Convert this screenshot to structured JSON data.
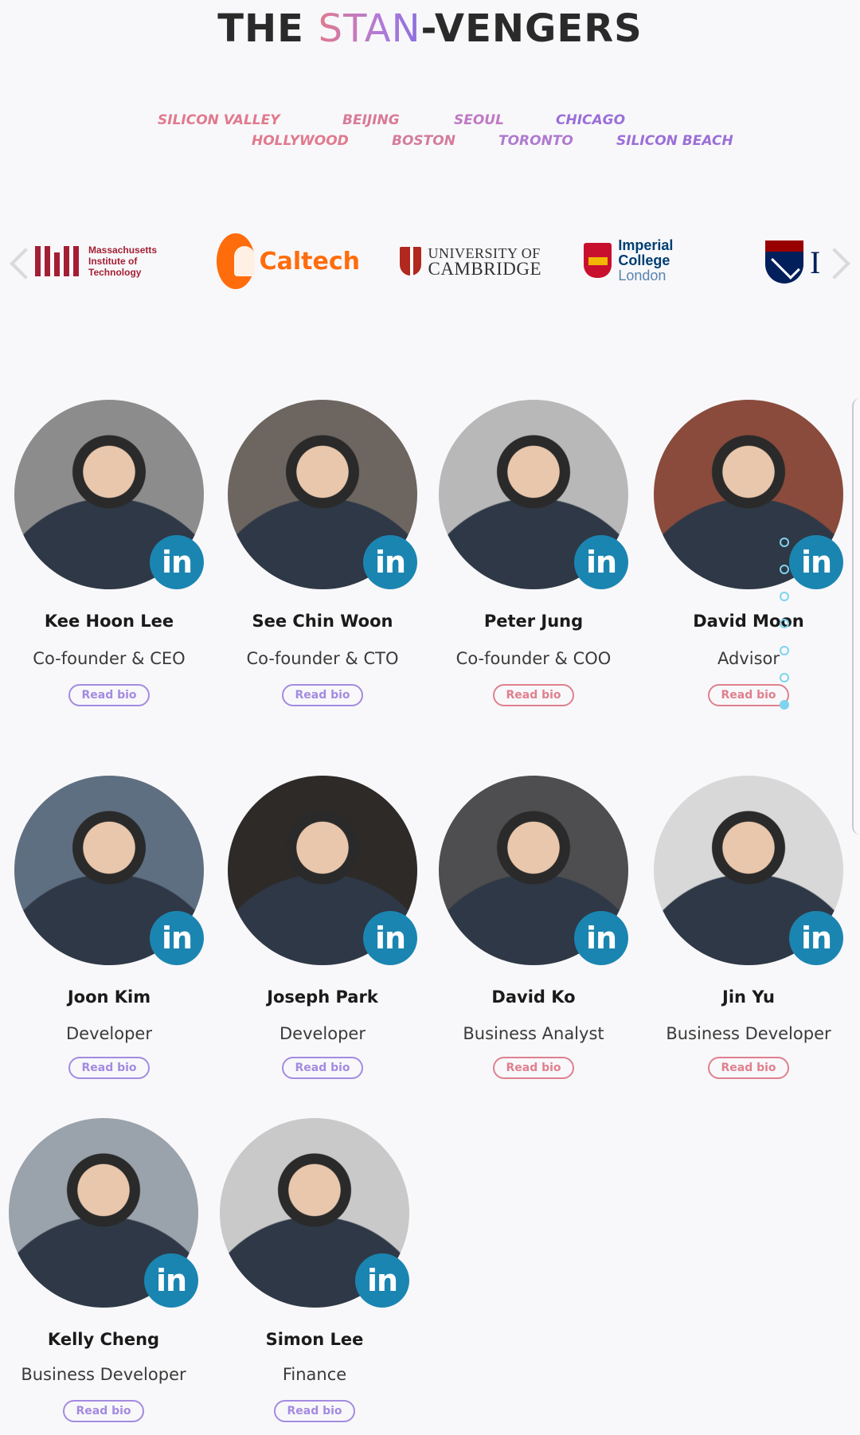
{
  "header": {
    "title_prefix": "THE ",
    "title_accent": "STAN",
    "title_suffix": "-VENGERS"
  },
  "cities": {
    "row1": [
      "SILICON VALLEY",
      "BEIJING",
      "SEOUL",
      "CHICAGO"
    ],
    "row2": [
      "HOLLYWOOD",
      "BOSTON",
      "TORONTO",
      "SILICON BEACH"
    ]
  },
  "universities": {
    "mit": [
      "Massachusetts",
      "Institute of",
      "Technology"
    ],
    "caltech": "Caltech",
    "cambridge": [
      "UNIVERSITY OF",
      "CAMBRIDGE"
    ],
    "imperial": [
      "Imperial College",
      "London"
    ],
    "penn_partial": "I"
  },
  "team": [
    {
      "name": "Kee Hoon Lee",
      "role": "Co-founder & CEO",
      "bio_label": "Read bio",
      "bio_color": "#a48be0"
    },
    {
      "name": "See Chin Woon",
      "role": "Co-founder & CTO",
      "bio_label": "Read bio",
      "bio_color": "#a48be0"
    },
    {
      "name": "Peter Jung",
      "role": "Co-founder & COO",
      "bio_label": "Read bio",
      "bio_color": "#e0808e"
    },
    {
      "name": "David Moon",
      "role": "Advisor",
      "bio_label": "Read bio",
      "bio_color": "#e0808e"
    },
    {
      "name": "Joon Kim",
      "role": "Developer",
      "bio_label": "Read bio",
      "bio_color": "#a48be0"
    },
    {
      "name": "Joseph Park",
      "role": "Developer",
      "bio_label": "Read bio",
      "bio_color": "#a48be0"
    },
    {
      "name": "David Ko",
      "role": "Business Analyst",
      "bio_label": "Read bio",
      "bio_color": "#e0808e"
    },
    {
      "name": "Jin Yu",
      "role": "Business Developer",
      "bio_label": "Read bio",
      "bio_color": "#e0808e"
    },
    {
      "name": "Kelly Cheng",
      "role": "Business Developer",
      "bio_label": "Read bio",
      "bio_color": "#a48be0"
    },
    {
      "name": "Simon Lee",
      "role": "Finance",
      "bio_label": "Read bio",
      "bio_color": "#a48be0"
    }
  ],
  "linkedin_label": "in",
  "colors": {
    "city_pink": "#e07a8e",
    "city_purple": "#9b6fd8",
    "linkedin": "#1b85b1",
    "scroll_indicator": "#7ed3ef"
  }
}
